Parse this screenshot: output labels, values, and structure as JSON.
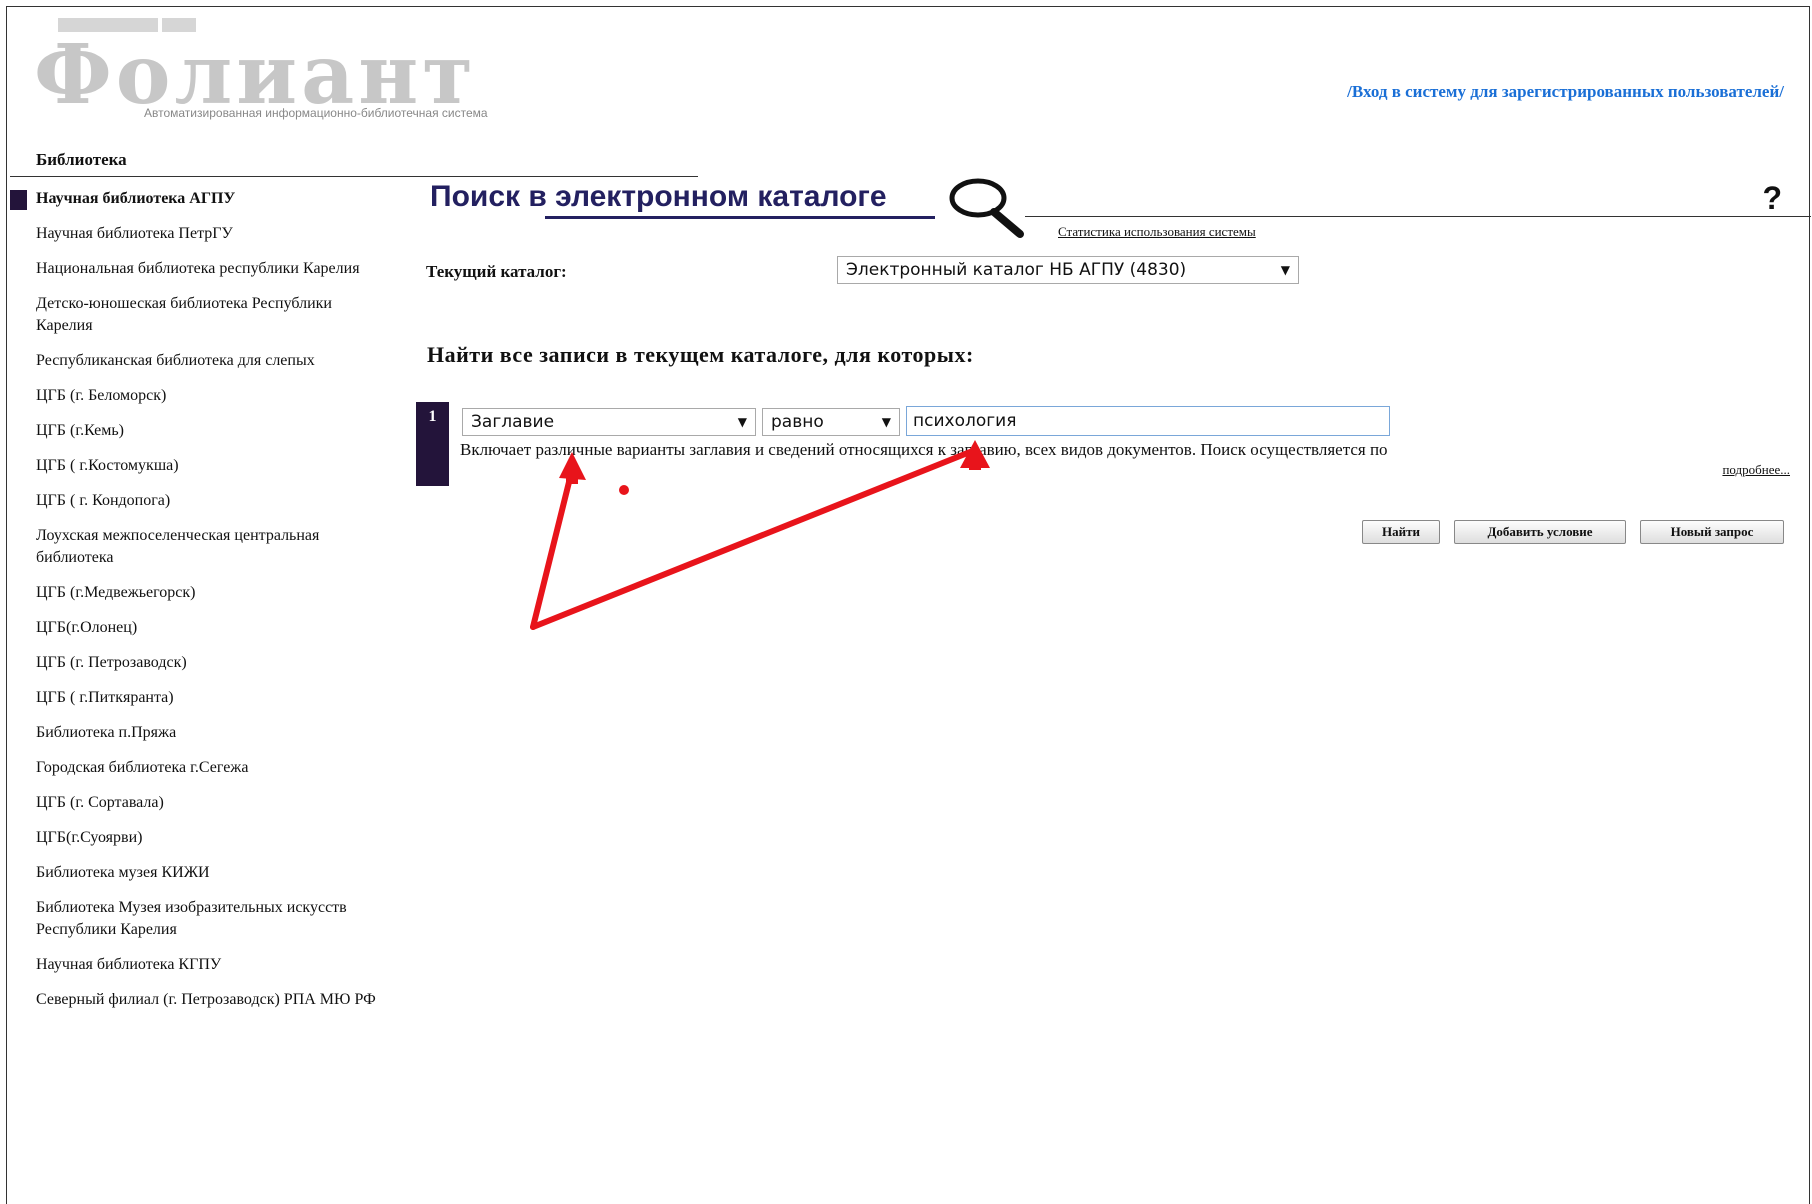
{
  "header": {
    "logo_word": "Фолиант",
    "logo_subtitle": "Автоматизированная информационно-библиотечная система",
    "login_link": "/Вход в систему для зарегистрированных пользователей/"
  },
  "sidebar": {
    "title": "Библиотека",
    "items": [
      {
        "label": "Научная библиотека АГПУ"
      },
      {
        "label": "Научная библиотека ПетрГУ"
      },
      {
        "label": "Национальная библиотека республики Карелия"
      },
      {
        "label": "Детско-юношеская библиотека Республики Карелия"
      },
      {
        "label": "Республиканская библиотека для слепых"
      },
      {
        "label": "ЦГБ (г. Беломорск)"
      },
      {
        "label": "ЦГБ (г.Кемь)"
      },
      {
        "label": "ЦГБ ( г.Костомукша)"
      },
      {
        "label": "ЦГБ ( г. Кондопога)"
      },
      {
        "label": "Лоухская межпоселенческая центральная библиотека"
      },
      {
        "label": "ЦГБ (г.Медвежьегорск)"
      },
      {
        "label": "ЦГБ(г.Олонец)"
      },
      {
        "label": "ЦГБ (г. Петрозаводск)"
      },
      {
        "label": "ЦГБ ( г.Питкяранта)"
      },
      {
        "label": "Библиотека п.Пряжа"
      },
      {
        "label": "Городская библиотека г.Сегежа"
      },
      {
        "label": "ЦГБ (г. Сортавала)"
      },
      {
        "label": "ЦГБ(г.Суоярви)"
      },
      {
        "label": "Библиотека музея КИЖИ"
      },
      {
        "label": "Библиотека Музея изобразительных искусств Республики Карелия"
      },
      {
        "label": "Научная библиотека КГПУ"
      },
      {
        "label": "Северный филиал (г. Петрозаводск) РПА МЮ РФ"
      }
    ]
  },
  "main": {
    "title": "Поиск в электронном каталоге",
    "help": "?",
    "stats_link": "Статистика использования системы",
    "current_catalog_label": "Текущий каталог:",
    "current_catalog_value": "Электронный каталог НБ АГПУ (4830)",
    "find_all_label": "Найти все записи в текущем каталоге, для которых:",
    "condition": {
      "number": "1",
      "field": "Заглавие",
      "operator": "равно",
      "value": "психология",
      "description": "Включает различные варианты заглавия и сведений относящихся к заглавию, всех видов документов. Поиск осуществляется по",
      "more_link": "подробнее..."
    },
    "buttons": {
      "find": "Найти",
      "add_condition": "Добавить условие",
      "new_query": "Новый запрос"
    }
  },
  "colors": {
    "accent_dark": "#23143a",
    "title_color": "#232060",
    "link_color": "#1a6fd6",
    "annotation_red": "#e8141b"
  }
}
